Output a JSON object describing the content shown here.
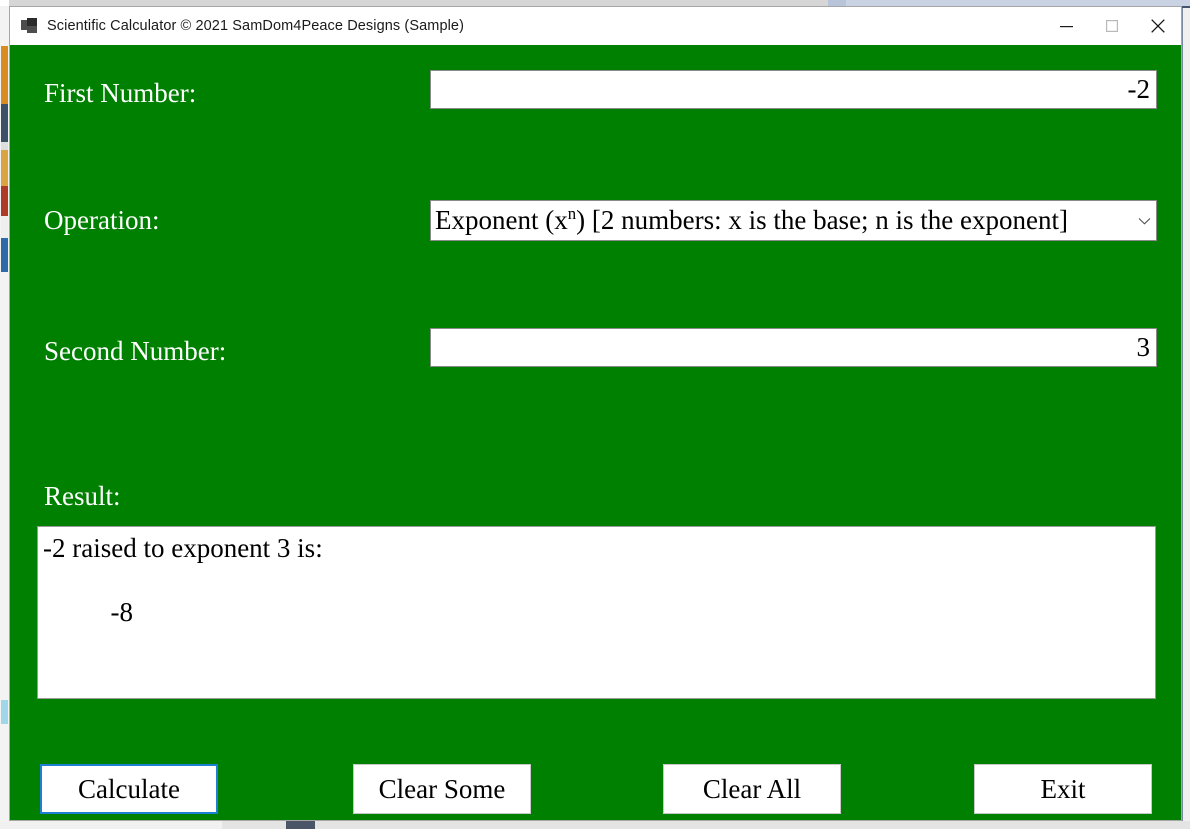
{
  "window": {
    "title": "Scientific Calculator © 2021 SamDom4Peace Designs (Sample)",
    "icon": "app-windows-icon",
    "background_color": "#008000",
    "controls": {
      "minimize": "minimize-icon",
      "maximize": "maximize-icon",
      "close": "close-icon"
    }
  },
  "form": {
    "first_number": {
      "label": "First Number:",
      "value": "-2",
      "placeholder": ""
    },
    "operation": {
      "label": "Operation:",
      "value_prefix": "Exponent (x",
      "value_sup": "n",
      "value_suffix": ") [2 numbers: x is the base; n is the exponent]",
      "value_plain": "Exponent (xⁿ) [2 numbers: x is the base; n is the exponent]",
      "chevron": "chevron-down-icon"
    },
    "second_number": {
      "label": "Second Number:",
      "value": "3",
      "placeholder": ""
    },
    "result": {
      "label": "Result:",
      "text": "-2 raised to exponent 3 is:\n\n          -8"
    }
  },
  "buttons": {
    "calculate": "Calculate",
    "clear_some": "Clear Some",
    "clear_all": "Clear All",
    "exit": "Exit",
    "focus_color": "#1f7fd0"
  }
}
